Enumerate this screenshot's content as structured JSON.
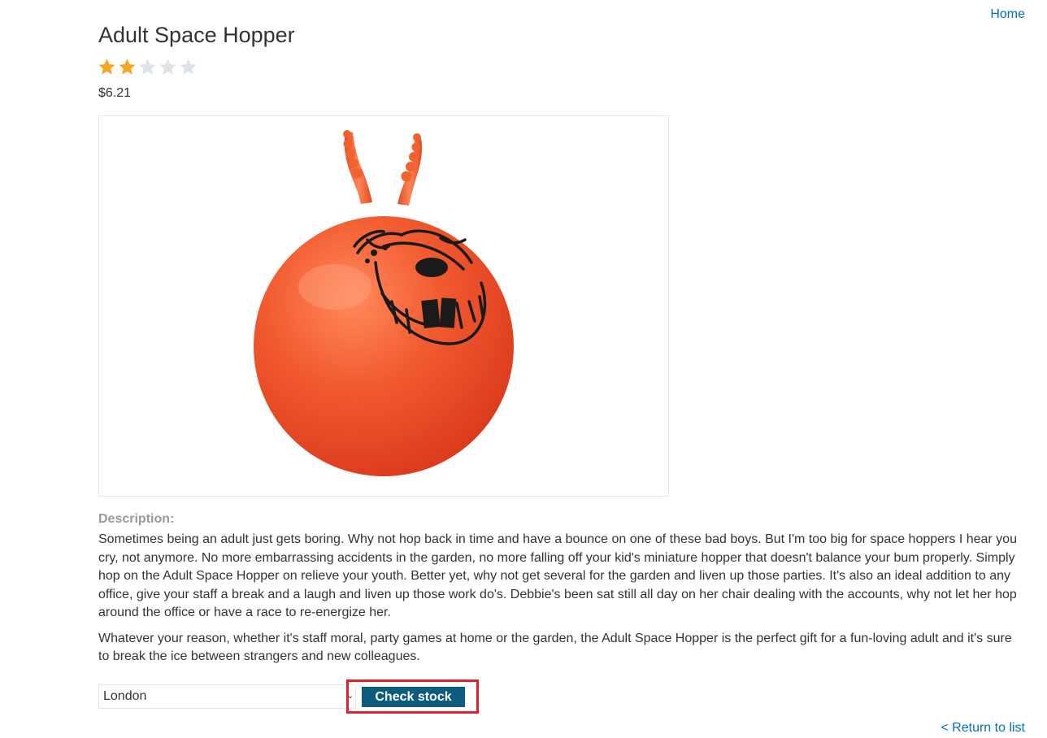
{
  "nav": {
    "home_label": "Home",
    "return_label": "< Return to list"
  },
  "product": {
    "title": "Adult Space Hopper",
    "rating": 2,
    "rating_max": 5,
    "price": "$6.21",
    "image_alt": "Orange space hopper with face and two horn handles"
  },
  "description": {
    "heading": "Description:",
    "paragraphs": [
      "Sometimes being an adult just gets boring. Why not hop back in time and have a bounce on one of these bad boys. But I'm too big for space hoppers I hear you cry, not anymore. No more embarrassing accidents in the garden, no more falling off your kid's miniature hopper that doesn't balance your bum properly. Simply hop on the Adult Space Hopper on relieve your youth. Better yet, why not get several for the garden and liven up those parties. It's also an ideal addition to any office, give your staff a break and a laugh and liven up those work do's. Debbie's been sat still all day on her chair dealing with the accounts, why not let her hop around the office or have a race to re-energize her.",
      "Whatever your reason, whether it's staff moral, party games at home or the garden, the Adult Space Hopper is the perfect gift for a fun-loving adult and it's sure to break the ice between strangers and new colleagues."
    ]
  },
  "stock": {
    "selected_store": "London",
    "button_label": "Check stock"
  },
  "colors": {
    "link": "#0071bc",
    "button": "#0d5c80",
    "star_filled": "#f5a623",
    "star_empty": "#dde3e8",
    "highlight": "#e0202a",
    "hopper": "#f0532b"
  },
  "icons": {
    "star": "star-icon",
    "select_arrow": "chevron-down-icon"
  }
}
